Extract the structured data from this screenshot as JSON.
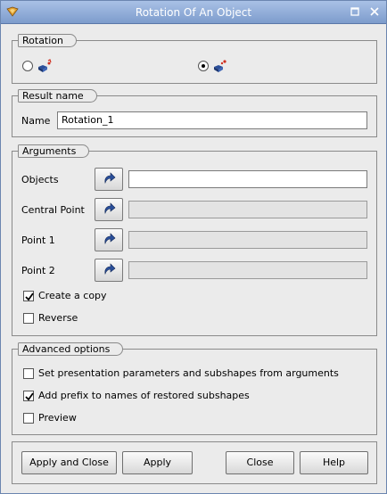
{
  "window": {
    "title": "Rotation Of An Object"
  },
  "rotation": {
    "group_title": "Rotation",
    "selected_index": 1
  },
  "result_name": {
    "group_title": "Result name",
    "name_label": "Name",
    "name_value": "Rotation_1"
  },
  "arguments": {
    "group_title": "Arguments",
    "rows": [
      {
        "label": "Objects",
        "value": "",
        "active": true
      },
      {
        "label": "Central Point",
        "value": "",
        "active": false
      },
      {
        "label": "Point 1",
        "value": "",
        "active": false
      },
      {
        "label": "Point 2",
        "value": "",
        "active": false
      }
    ],
    "create_copy": {
      "label": "Create a copy",
      "checked": true
    },
    "reverse": {
      "label": "Reverse",
      "checked": false
    }
  },
  "advanced": {
    "group_title": "Advanced options",
    "set_presentation": {
      "label": "Set presentation parameters and subshapes from arguments",
      "checked": false
    },
    "add_prefix": {
      "label": "Add prefix to names of restored subshapes",
      "checked": true
    },
    "preview": {
      "label": "Preview",
      "checked": false
    }
  },
  "buttons": {
    "apply_close": "Apply and Close",
    "apply": "Apply",
    "close": "Close",
    "help": "Help"
  },
  "colors": {
    "titlebar": "#8aa6d4",
    "accent_blue": "#2b4f9a"
  }
}
